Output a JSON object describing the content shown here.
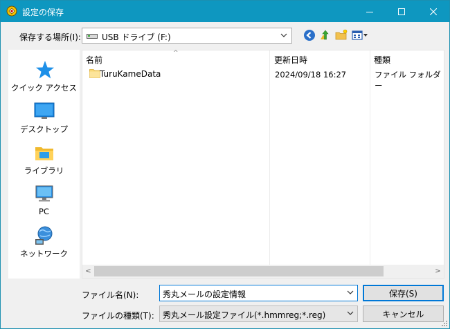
{
  "window": {
    "title": "設定の保存",
    "colors": {
      "titlebar": "#0e97c0",
      "accent": "#0078d7"
    }
  },
  "titlebar_buttons": {
    "minimize_icon": "minimize-icon",
    "maximize_icon": "maximize-icon",
    "close_icon": "close-icon"
  },
  "location": {
    "label": "保存する場所(I):",
    "value": "USB ドライブ (F:)",
    "icon": "usb-drive-icon"
  },
  "toolbar": {
    "icons": [
      "back-icon",
      "up-folder-icon",
      "new-folder-icon",
      "view-menu-icon"
    ]
  },
  "places": [
    {
      "label": "クイック アクセス",
      "icon": "star-icon"
    },
    {
      "label": "デスクトップ",
      "icon": "desktop-icon"
    },
    {
      "label": "ライブラリ",
      "icon": "library-icon"
    },
    {
      "label": "PC",
      "icon": "pc-icon"
    },
    {
      "label": "ネットワーク",
      "icon": "network-icon"
    }
  ],
  "filelist": {
    "columns": [
      "名前",
      "更新日時",
      "種類"
    ],
    "rows": [
      {
        "name": "TuruKameData",
        "date": "2024/09/18 16:27",
        "type": "ファイル フォルダー",
        "icon": "folder-icon"
      }
    ]
  },
  "filename": {
    "label": "ファイル名(N):",
    "value": "秀丸メールの設定情報"
  },
  "filetype": {
    "label": "ファイルの種類(T):",
    "value": "秀丸メール設定ファイル(*.hmmreg;*.reg)"
  },
  "buttons": {
    "save": "保存(S)",
    "cancel": "キャンセル"
  }
}
